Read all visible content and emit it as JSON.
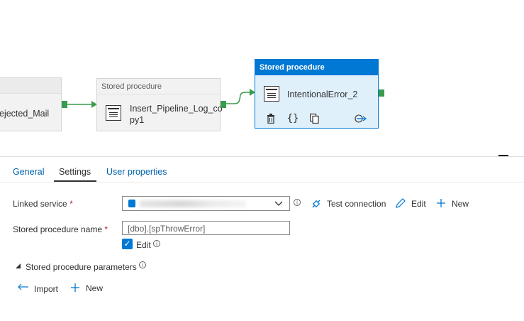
{
  "pipeline": {
    "nodes": [
      {
        "header": "",
        "title": "ejected_Mail"
      },
      {
        "header": "Stored procedure",
        "title_line1": "Insert_Pipeline_Log_co",
        "title_line2": "py1"
      },
      {
        "header": "Stored procedure",
        "title": "IntentionalError_2"
      }
    ]
  },
  "tabs": [
    {
      "label": "General"
    },
    {
      "label": "Settings",
      "active": true
    },
    {
      "label": "User properties"
    }
  ],
  "settings": {
    "linked_service_label": "Linked service",
    "required_mark": "*",
    "test_connection_label": "Test connection",
    "edit_label": "Edit",
    "new_label": "New",
    "stored_proc_label": "Stored procedure name",
    "stored_proc_value": "[dbo].[spThrowError]",
    "edit_checkbox_label": "Edit",
    "params_label": "Stored procedure parameters",
    "import_label": "Import",
    "params_new_label": "New"
  },
  "icons": {
    "delete": "trash-icon",
    "code": "braces-icon",
    "copy": "copy-icon",
    "output": "output-arrow-icon"
  },
  "colors": {
    "accent": "#0078d4",
    "port": "#3a9b4a"
  }
}
